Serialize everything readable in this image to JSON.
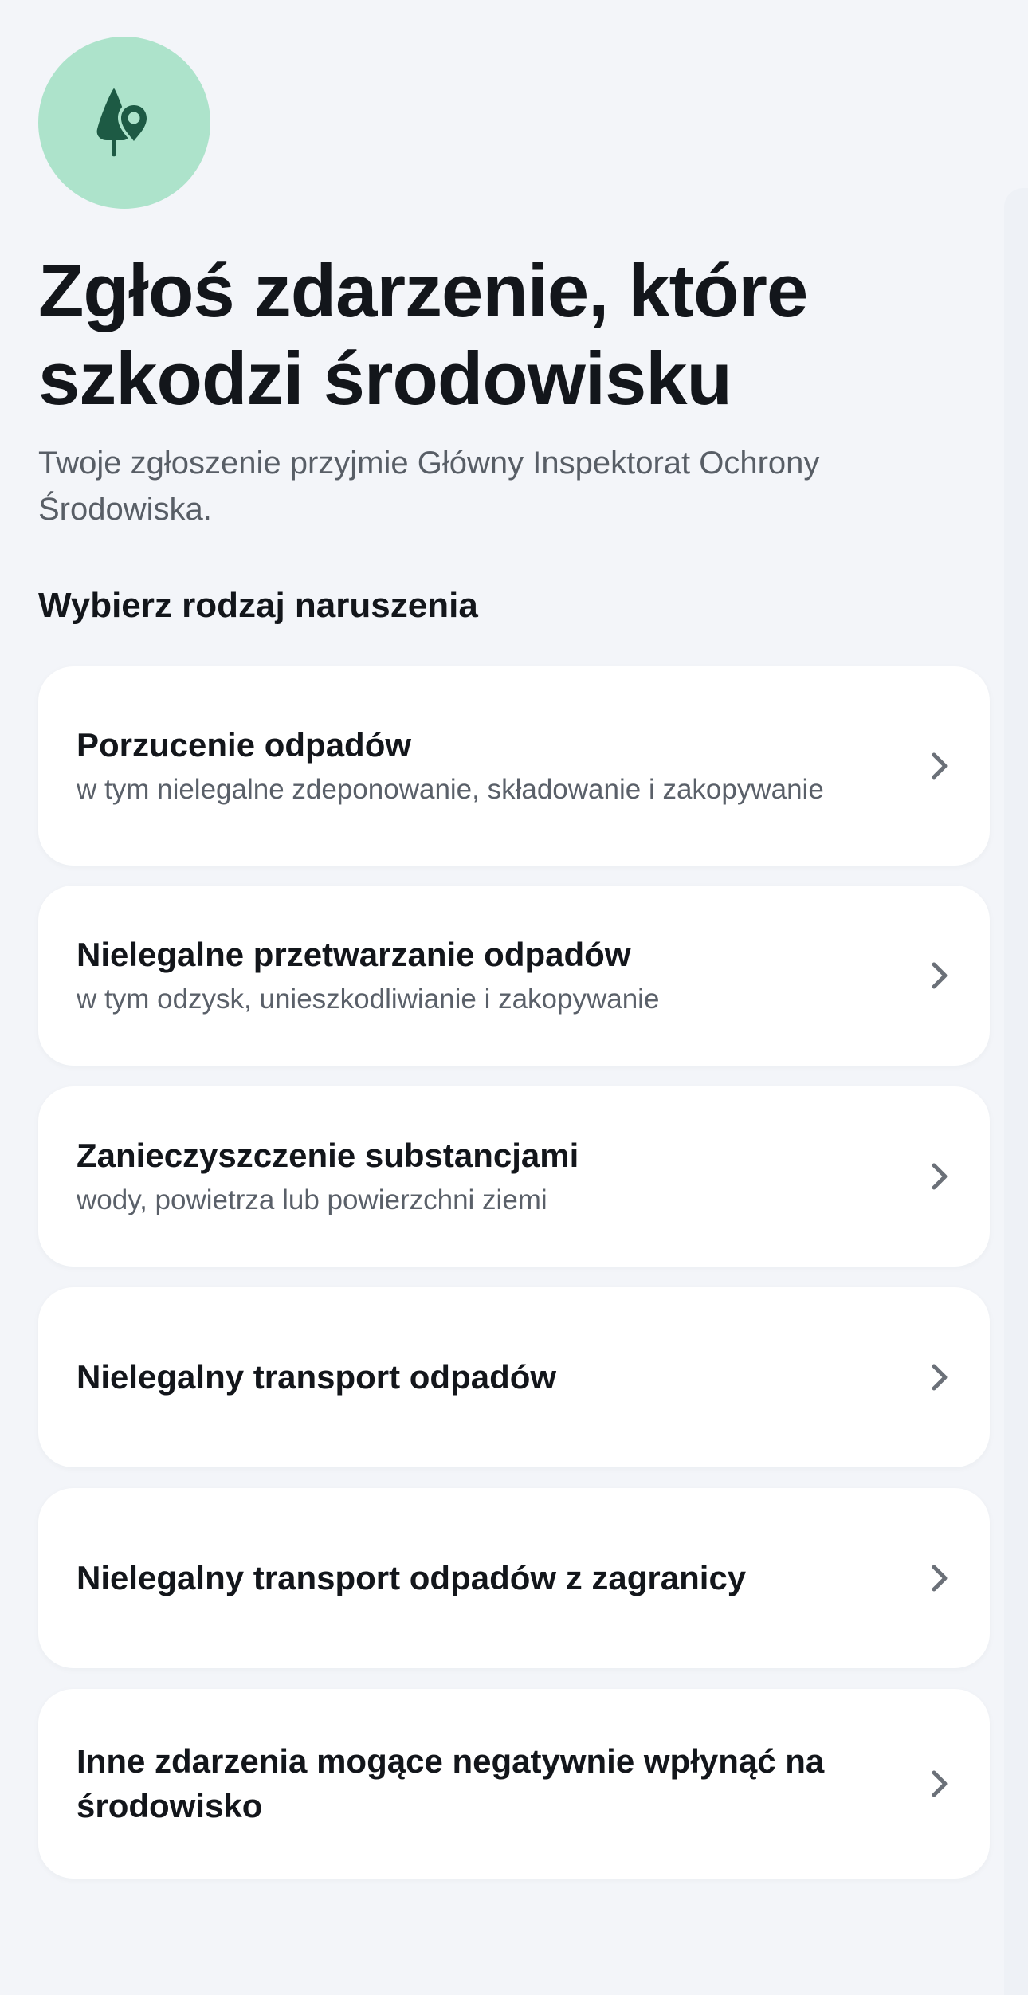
{
  "header": {
    "icon": "tree-location-icon",
    "icon_bg_color": "#ade3cb",
    "icon_color": "#1d5a44",
    "title": "Zgłoś zdarzenie, które szkodzi środowisku",
    "subtitle": "Twoje zgłoszenie przyjmie Główny Inspektorat Ochrony Środowiska."
  },
  "section": {
    "label": "Wybierz rodzaj naruszenia"
  },
  "options": [
    {
      "title": "Porzucenie odpadów",
      "description": "w tym nielegalne zdeponowanie, składowanie i zakopywanie"
    },
    {
      "title": "Nielegalne przetwarzanie odpadów",
      "description": "w tym odzysk, unieszkodliwianie i zakopywanie"
    },
    {
      "title": "Zanieczyszczenie substancjami",
      "description": "wody, powietrza lub powierzchni ziemi"
    },
    {
      "title": "Nielegalny transport odpadów"
    },
    {
      "title": "Nielegalny transport odpadów z zagranicy"
    },
    {
      "title": "Inne zdarzenia mogące negatywnie wpłynąć na środowisko"
    }
  ],
  "chevron_icon": "chevron-right-icon",
  "colors": {
    "background": "#f3f5f9",
    "card": "#ffffff",
    "text_primary": "#13161b",
    "text_secondary": "#5a6069",
    "chevron": "#6b7078"
  }
}
